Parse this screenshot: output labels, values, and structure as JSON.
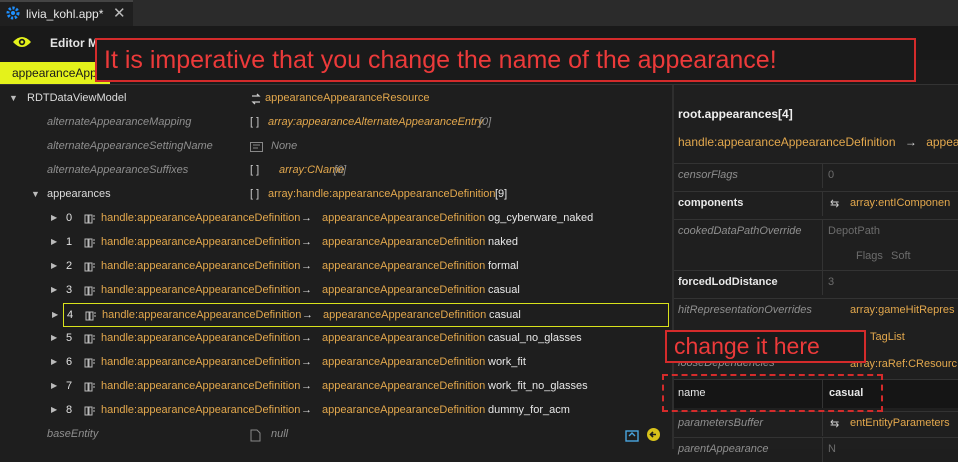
{
  "window": {
    "tab_title": "livia_kohl.app*",
    "close_glyph": "✕"
  },
  "toolbar": {
    "editor_label": "Editor M"
  },
  "subtab": {
    "label": "appearanceApp"
  },
  "banner": {
    "text": "It is imperative that you change the name of the appearance!"
  },
  "callout": {
    "text": "change it here"
  },
  "tree": {
    "root_label": "RDTDataViewModel",
    "root_value": "appearanceAppearanceResource",
    "fields": [
      {
        "key": "alternateAppearanceMapping",
        "bracket": "[ ]",
        "type": "array:appearanceAlternateAppearanceEntry",
        "count": "[0]"
      },
      {
        "key": "alternateAppearanceSettingName",
        "value": "None"
      },
      {
        "key": "alternateAppearanceSuffixes",
        "bracket": "[ ]",
        "type": "array:CName",
        "count": "[0]"
      }
    ],
    "appearances": {
      "key": "appearances",
      "bracket": "[ ]",
      "type": "array:handle:appearanceAppearanceDefinition",
      "count": "[9]",
      "items": [
        {
          "index": "0",
          "handle": "handle:appearanceAppearanceDefinition",
          "target": "appearanceAppearanceDefinition",
          "name": "og_cyberware_naked"
        },
        {
          "index": "1",
          "handle": "handle:appearanceAppearanceDefinition",
          "target": "appearanceAppearanceDefinition",
          "name": "naked"
        },
        {
          "index": "2",
          "handle": "handle:appearanceAppearanceDefinition",
          "target": "appearanceAppearanceDefinition",
          "name": "formal"
        },
        {
          "index": "3",
          "handle": "handle:appearanceAppearanceDefinition",
          "target": "appearanceAppearanceDefinition",
          "name": "casual"
        },
        {
          "index": "4",
          "handle": "handle:appearanceAppearanceDefinition",
          "target": "appearanceAppearanceDefinition",
          "name": "casual"
        },
        {
          "index": "5",
          "handle": "handle:appearanceAppearanceDefinition",
          "target": "appearanceAppearanceDefinition",
          "name": "casual_no_glasses"
        },
        {
          "index": "6",
          "handle": "handle:appearanceAppearanceDefinition",
          "target": "appearanceAppearanceDefinition",
          "name": "work_fit"
        },
        {
          "index": "7",
          "handle": "handle:appearanceAppearanceDefinition",
          "target": "appearanceAppearanceDefinition",
          "name": "work_fit_no_glasses"
        },
        {
          "index": "8",
          "handle": "handle:appearanceAppearanceDefinition",
          "target": "appearanceAppearanceDefinition",
          "name": "dummy_for_acm"
        }
      ],
      "selected_index": "4"
    },
    "base_entity": {
      "key": "baseEntity",
      "value": "null"
    }
  },
  "inspector": {
    "path": "root.appearances[4]",
    "handle": "handle:appearanceAppearanceDefinition",
    "handle_target": "appear",
    "props": {
      "censorFlags": {
        "key": "censorFlags",
        "value": "0"
      },
      "components": {
        "key": "components",
        "value": "array:entIComponen"
      },
      "cookedDataPathOverride": {
        "key": "cookedDataPathOverride",
        "depot": "DepotPath",
        "flags": "Flags",
        "soft": "Soft"
      },
      "forcedLodDistance": {
        "key": "forcedLodDistance",
        "value": "3"
      },
      "hitRepresentationOverrides": {
        "key": "hitRepresentationOverrides",
        "value": "array:gameHitRepres"
      },
      "tagList": {
        "value": "TagList"
      },
      "looseDependencies": {
        "key": "looseDependencies",
        "value": "array:raRef:CResourc"
      },
      "name": {
        "key": "name",
        "value": "casual"
      },
      "parametersBuffer": {
        "key": "parametersBuffer",
        "value": "entEntityParameters"
      },
      "parentAppearance": {
        "key": "parentAppearance",
        "value": "N"
      }
    }
  },
  "colors": {
    "accent": "#e4f21b",
    "warning": "#d42b2b",
    "type_text": "#e3a84d"
  }
}
